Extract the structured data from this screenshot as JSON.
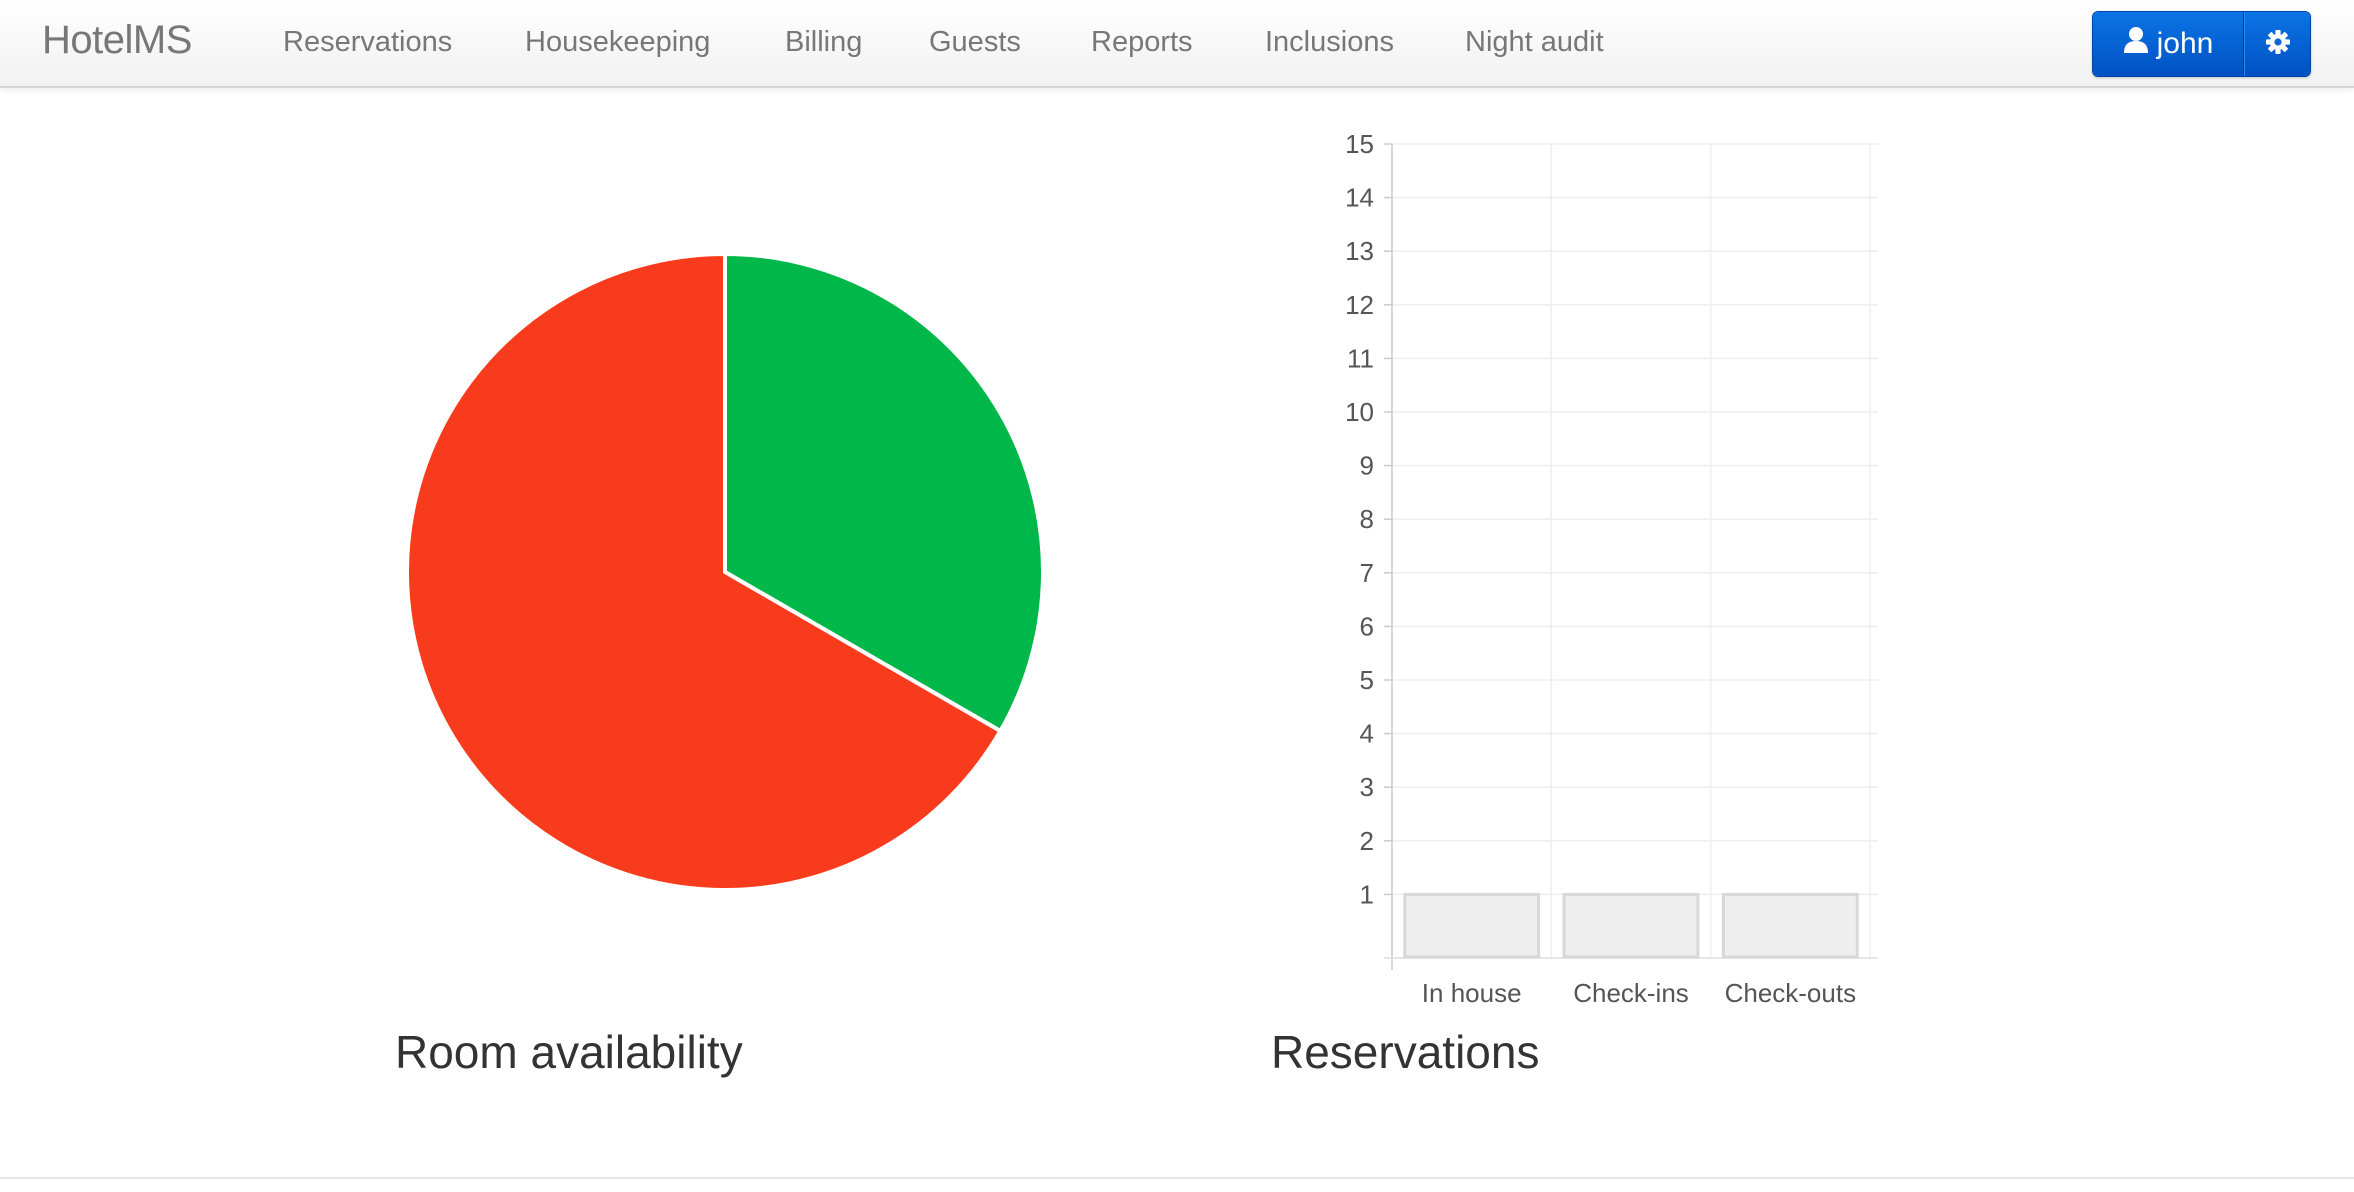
{
  "app": {
    "brand": "HotelMS"
  },
  "nav": {
    "items": [
      {
        "label": "Reservations"
      },
      {
        "label": "Housekeeping"
      },
      {
        "label": "Billing"
      },
      {
        "label": "Guests"
      },
      {
        "label": "Reports"
      },
      {
        "label": "Inclusions"
      },
      {
        "label": "Night audit"
      }
    ]
  },
  "user": {
    "name": "john",
    "icon": "user-icon",
    "settings_icon": "gear-icon",
    "button_color": "#0058cc"
  },
  "captions": {
    "room_availability": "Room availability",
    "reservations": "Reservations"
  },
  "chart_data": [
    {
      "type": "pie",
      "title": "Room availability",
      "slices": [
        {
          "value": 1,
          "color": "#00b84a"
        },
        {
          "value": 2,
          "color": "#f93b1d"
        }
      ],
      "legend": "none"
    },
    {
      "type": "bar",
      "title": "Reservations",
      "categories": [
        "In house",
        "Check-ins",
        "Check-outs"
      ],
      "values": [
        1,
        1,
        1
      ],
      "ylim": [
        0,
        15
      ],
      "yticks": [
        1,
        2,
        3,
        4,
        5,
        6,
        7,
        8,
        9,
        10,
        11,
        12,
        13,
        14,
        15
      ],
      "grid": true,
      "bar_color": "#eeeeee",
      "bar_border": "#d8d8d8",
      "legend": "none"
    }
  ]
}
